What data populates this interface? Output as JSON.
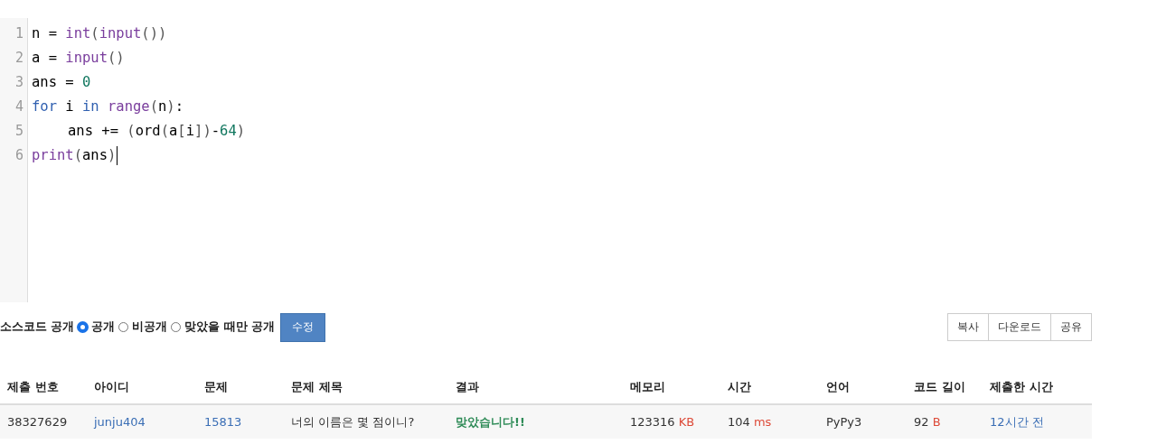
{
  "editor": {
    "lines": [
      {
        "number": "1",
        "indent": false,
        "tokens": [
          {
            "kind": "plain",
            "text": "n = "
          },
          {
            "kind": "builtin",
            "text": "int"
          },
          {
            "kind": "bracket",
            "text": "("
          },
          {
            "kind": "builtin",
            "text": "input"
          },
          {
            "kind": "bracket",
            "text": "())"
          }
        ]
      },
      {
        "number": "2",
        "indent": false,
        "tokens": [
          {
            "kind": "plain",
            "text": "a = "
          },
          {
            "kind": "builtin",
            "text": "input"
          },
          {
            "kind": "bracket",
            "text": "()"
          }
        ]
      },
      {
        "number": "3",
        "indent": false,
        "tokens": [
          {
            "kind": "plain",
            "text": "ans = "
          },
          {
            "kind": "number",
            "text": "0"
          }
        ]
      },
      {
        "number": "4",
        "indent": false,
        "tokens": [
          {
            "kind": "keyword",
            "text": "for"
          },
          {
            "kind": "plain",
            "text": " i "
          },
          {
            "kind": "keyword",
            "text": "in "
          },
          {
            "kind": "builtin",
            "text": "range"
          },
          {
            "kind": "bracket",
            "text": "("
          },
          {
            "kind": "plain",
            "text": "n"
          },
          {
            "kind": "bracket",
            "text": ")"
          },
          {
            "kind": "plain",
            "text": ":"
          }
        ]
      },
      {
        "number": "5",
        "indent": true,
        "tokens": [
          {
            "kind": "plain",
            "text": "ans += "
          },
          {
            "kind": "bracket",
            "text": "("
          },
          {
            "kind": "plain",
            "text": "ord"
          },
          {
            "kind": "bracket",
            "text": "("
          },
          {
            "kind": "plain",
            "text": "a"
          },
          {
            "kind": "bracket",
            "text": "["
          },
          {
            "kind": "plain",
            "text": "i"
          },
          {
            "kind": "bracket",
            "text": "])"
          },
          {
            "kind": "plain",
            "text": "-"
          },
          {
            "kind": "number",
            "text": "64"
          },
          {
            "kind": "bracket",
            "text": ")"
          }
        ]
      },
      {
        "number": "6",
        "indent": false,
        "cursor": true,
        "tokens": [
          {
            "kind": "builtin",
            "text": "print"
          },
          {
            "kind": "bracket",
            "text": "("
          },
          {
            "kind": "plain",
            "text": "ans"
          },
          {
            "kind": "bracket",
            "text": ")"
          }
        ]
      }
    ]
  },
  "visibility": {
    "label": "소스코드 공개",
    "options": [
      {
        "label": "공개",
        "selected": true
      },
      {
        "label": "비공개",
        "selected": false
      },
      {
        "label": "맞았을 때만 공개",
        "selected": false
      }
    ],
    "save_button": "수정"
  },
  "actions": [
    "복사",
    "다운로드",
    "공유"
  ],
  "table": {
    "columns": [
      "제출 번호",
      "아이디",
      "문제",
      "문제 제목",
      "결과",
      "메모리",
      "시간",
      "언어",
      "코드 길이",
      "제출한 시간"
    ],
    "rows": [
      [
        {
          "kind": "plain",
          "text": "38327629"
        },
        {
          "kind": "link",
          "text": "junju404"
        },
        {
          "kind": "link",
          "text": "15813"
        },
        {
          "kind": "plain",
          "text": "너의 이름은 몇 점이니?"
        },
        {
          "kind": "result",
          "text": "맞았습니다!!"
        },
        {
          "kind": "measure",
          "text": "123316",
          "unit": "KB"
        },
        {
          "kind": "measure",
          "text": "104",
          "unit": "ms"
        },
        {
          "kind": "plain",
          "text": "PyPy3"
        },
        {
          "kind": "measure",
          "text": "92",
          "unit": "B"
        },
        {
          "kind": "link",
          "text": "12시간 전"
        }
      ]
    ]
  }
}
